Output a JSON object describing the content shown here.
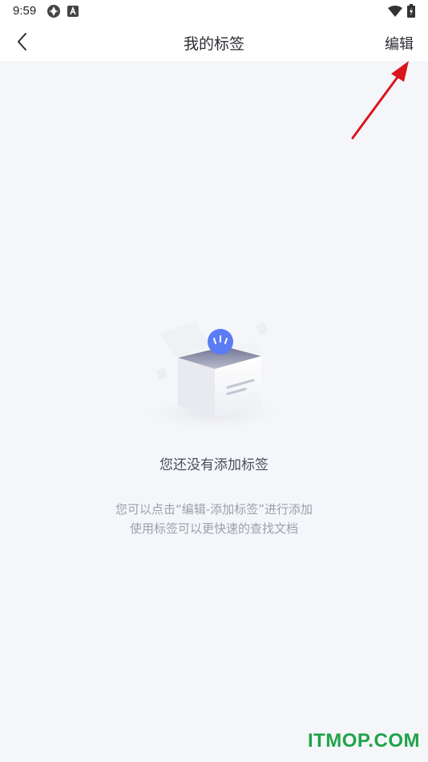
{
  "status_bar": {
    "time": "9:59",
    "icons": [
      "app-notification-icon",
      "a-notification-icon",
      "wifi-icon",
      "battery-icon"
    ]
  },
  "header": {
    "back_icon": "chevron-left-icon",
    "title": "我的标签",
    "edit_label": "编辑"
  },
  "empty_state": {
    "title": "您还没有添加标签",
    "hint_line_1": "您可以点击“编辑-添加标签”进行添加",
    "hint_line_2": "使用标签可以更快速的查找文档",
    "illustration": "empty-box-icon"
  },
  "watermark": "ITMOP.COM",
  "colors": {
    "background": "#f5f6f9",
    "header_bg": "#ffffff",
    "text_primary": "#2a2d33",
    "text_hint": "#9aa1ad",
    "accent_blue": "#5b7cf5",
    "annotation_red": "#d9161c",
    "watermark_green": "#1fa34a"
  }
}
